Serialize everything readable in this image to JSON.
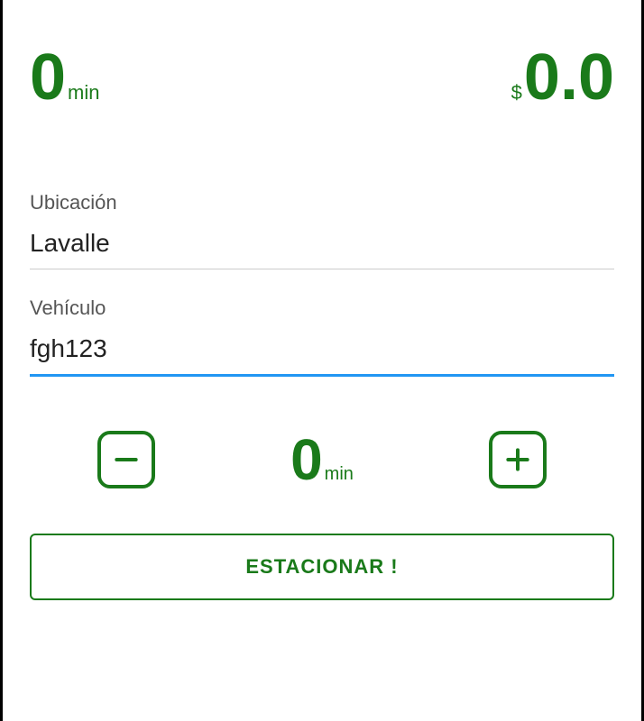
{
  "colors": {
    "primary": "#1a7a1a",
    "focus": "#2196F3"
  },
  "top": {
    "time_value": "0",
    "time_unit": "min",
    "price_currency": "$",
    "price_value": "0.0"
  },
  "fields": {
    "location": {
      "label": "Ubicación",
      "value": "Lavalle"
    },
    "vehicle": {
      "label": "Vehículo",
      "value": "fgh123"
    }
  },
  "stepper": {
    "value": "0",
    "unit": "min"
  },
  "actions": {
    "park_label": "ESTACIONAR !"
  }
}
